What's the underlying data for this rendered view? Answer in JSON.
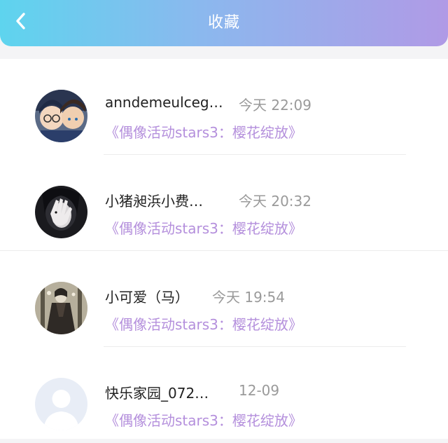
{
  "header": {
    "title": "收藏",
    "back_icon": "chevron-left-icon",
    "gradient": [
      "#5ed4ee",
      "#b09ae6"
    ]
  },
  "items": [
    {
      "name": "anndemeulceg…",
      "time": "今天 22:09",
      "work": "《偶像活动stars3：樱花绽放》",
      "avatar": "anime-duo-avatar"
    },
    {
      "name": "小猪昶浜小费…",
      "time": "今天 20:32",
      "work": "《偶像活动stars3：樱花绽放》",
      "avatar": "hand-over-face-avatar"
    },
    {
      "name": "小可爱（马）",
      "time": "今天 19:54",
      "work": "《偶像活动stars3：樱花绽放》",
      "avatar": "gothic-figure-avatar"
    },
    {
      "name": "快乐家园_072…",
      "time": "12-09",
      "work": "《偶像活动stars3：樱花绽放》",
      "avatar": "default-user-avatar"
    }
  ],
  "colors": {
    "work_link": "#b48fdc",
    "time": "#9a9a9a",
    "name": "#222222"
  }
}
